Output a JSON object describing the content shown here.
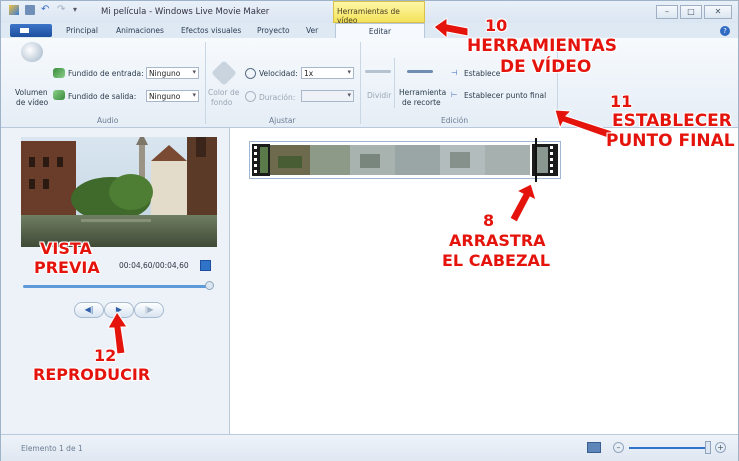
{
  "window": {
    "title": "Mi película - Windows Live Movie Maker",
    "contextual_tab_group": "Herramientas de vídeo"
  },
  "tabs": [
    "Principal",
    "Animaciones",
    "Efectos visuales",
    "Proyecto",
    "Ver",
    "Editar"
  ],
  "active_tab": "Editar",
  "ribbon": {
    "audio": {
      "group_label": "Audio",
      "volume_label_1": "Volumen",
      "volume_label_2": "de vídeo",
      "fade_in_label": "Fundido de entrada:",
      "fade_in_value": "Ninguno",
      "fade_out_label": "Fundido de salida:",
      "fade_out_value": "Ninguno"
    },
    "ajustar": {
      "group_label": "Ajustar",
      "bg_color_1": "Color de",
      "bg_color_2": "fondo",
      "speed_label": "Velocidad:",
      "speed_value": "1x",
      "duration_label": "Duración:",
      "duration_value": ""
    },
    "edicion": {
      "group_label": "Edición",
      "split_label": "Dividir",
      "trim_tool_1": "Herramienta",
      "trim_tool_2": "de recorte",
      "set_start": "Establecer punto de inicio",
      "set_end": "Establecer punto final"
    }
  },
  "preview": {
    "timecode": "00:04,60/00:04,60",
    "progress_fraction": 1.0
  },
  "status": {
    "text": "Elemento 1 de 1"
  },
  "annotations": {
    "a10_num": "10",
    "a10_line1": "HERRAMIENTAS",
    "a10_line2": "DE VÍDEO",
    "a11_num": "11",
    "a11_line1": "ESTABLECER",
    "a11_line2": "PUNTO FINAL",
    "a8_num": "8",
    "a8_line1": "ARRASTRA",
    "a8_line2": "EL CABEZAL",
    "vista_1": "VISTA",
    "vista_2": "PREVIA",
    "a12_num": "12",
    "a12_line1": "REPRODUCIR"
  },
  "colors": {
    "annotation": "#e4140c",
    "contextual_tab": "#f4e35a"
  }
}
